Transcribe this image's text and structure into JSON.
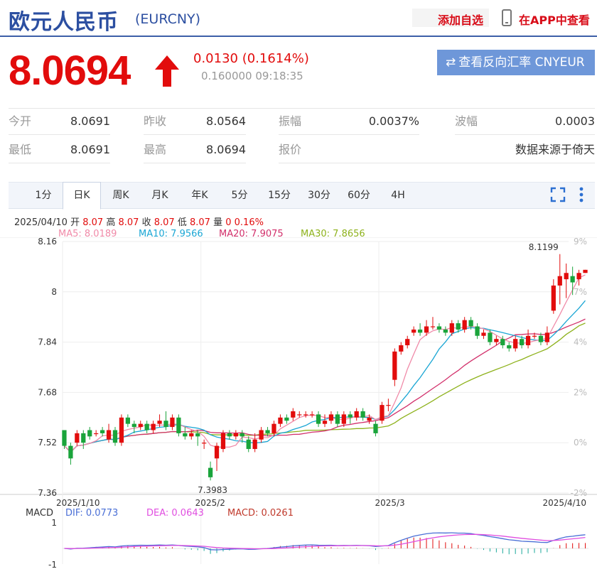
{
  "header": {
    "name": "欧元人民币",
    "code": "(EURCNY)",
    "add_watch": "添加自选",
    "app_view": "在APP中查看"
  },
  "quote": {
    "price": "8.0694",
    "change": "0.0130 (0.1614%)",
    "sub": "0.160000 09:18:35",
    "reverse_button": "查看反向汇率 CNYEUR"
  },
  "stats": [
    {
      "label": "今开",
      "value": "8.0691"
    },
    {
      "label": "昨收",
      "value": "8.0564"
    },
    {
      "label": "振幅",
      "value": "0.0037%"
    },
    {
      "label": "波幅",
      "value": "0.0003"
    },
    {
      "label": "最低",
      "value": "8.0691"
    },
    {
      "label": "最高",
      "value": "8.0694"
    },
    {
      "label": "报价",
      "value": ""
    },
    {
      "label": "",
      "value": "数据来源于倚天"
    }
  ],
  "tabs": [
    "1分",
    "日K",
    "周K",
    "月K",
    "年K",
    "5分",
    "15分",
    "30分",
    "60分",
    "4H"
  ],
  "active_tab": "日K",
  "info": {
    "date": "2025/04/10",
    "open_label": "开",
    "open": "8.07",
    "high_label": "高",
    "high": "8.07",
    "close_label": "收",
    "close": "8.07",
    "low_label": "低",
    "low": "8.07",
    "vol_label": "量",
    "vol": "0",
    "pct": "0.16%"
  },
  "ma_legend": [
    {
      "text": "MA5: 8.0189",
      "color": "#f08aa8"
    },
    {
      "text": "MA10: 7.9566",
      "color": "#1aa6d4"
    },
    {
      "text": "MA20: 7.9075",
      "color": "#d2306b"
    },
    {
      "text": "MA30: 7.8656",
      "color": "#8eb21c"
    }
  ],
  "macd_legend": {
    "label": "MACD",
    "dif": "DIF: 0.0773",
    "dea": "DEA: 0.0643",
    "macd": "MACD: 0.0261"
  },
  "colors": {
    "up": "#e20c0c",
    "down": "#1aa43b",
    "accent": "#2c4fa1",
    "button": "#6e97d9"
  },
  "chart_data": {
    "type": "candlestick",
    "y_ticks": [
      "8.16",
      "8",
      "7.84",
      "7.68",
      "7.52",
      "7.36"
    ],
    "y_pct_ticks": [
      "9%",
      "7%",
      "4%",
      "2%",
      "0%",
      "-2%"
    ],
    "x_ticks": [
      "2025/1/10",
      "2025/2",
      "2025/3",
      "2025/4/10"
    ],
    "ylim": [
      7.36,
      8.16
    ],
    "annotations": {
      "max": "8.1199",
      "min": "7.3983"
    },
    "macd_y_ticks": [
      "1",
      "-1"
    ],
    "candles": [
      {
        "o": 7.56,
        "c": 7.51,
        "h": 7.56,
        "l": 7.5
      },
      {
        "o": 7.51,
        "c": 7.47,
        "h": 7.52,
        "l": 7.45
      },
      {
        "o": 7.52,
        "c": 7.55,
        "h": 7.56,
        "l": 7.51
      },
      {
        "o": 7.55,
        "c": 7.52,
        "h": 7.56,
        "l": 7.5
      },
      {
        "o": 7.56,
        "c": 7.54,
        "h": 7.57,
        "l": 7.53
      },
      {
        "o": 7.55,
        "c": 7.55,
        "h": 7.56,
        "l": 7.54
      },
      {
        "o": 7.56,
        "c": 7.55,
        "h": 7.57,
        "l": 7.54
      },
      {
        "o": 7.53,
        "c": 7.56,
        "h": 7.58,
        "l": 7.52
      },
      {
        "o": 7.56,
        "c": 7.52,
        "h": 7.57,
        "l": 7.51
      },
      {
        "o": 7.52,
        "c": 7.6,
        "h": 7.61,
        "l": 7.51
      },
      {
        "o": 7.6,
        "c": 7.58,
        "h": 7.61,
        "l": 7.57
      },
      {
        "o": 7.58,
        "c": 7.57,
        "h": 7.59,
        "l": 7.55
      },
      {
        "o": 7.57,
        "c": 7.58,
        "h": 7.59,
        "l": 7.56
      },
      {
        "o": 7.58,
        "c": 7.56,
        "h": 7.59,
        "l": 7.55
      },
      {
        "o": 7.56,
        "c": 7.58,
        "h": 7.59,
        "l": 7.55
      },
      {
        "o": 7.58,
        "c": 7.59,
        "h": 7.61,
        "l": 7.57
      },
      {
        "o": 7.59,
        "c": 7.57,
        "h": 7.62,
        "l": 7.56
      },
      {
        "o": 7.57,
        "c": 7.6,
        "h": 7.61,
        "l": 7.56
      },
      {
        "o": 7.6,
        "c": 7.55,
        "h": 7.61,
        "l": 7.54
      },
      {
        "o": 7.55,
        "c": 7.54,
        "h": 7.57,
        "l": 7.53
      },
      {
        "o": 7.54,
        "c": 7.55,
        "h": 7.56,
        "l": 7.53
      },
      {
        "o": 7.55,
        "c": 7.54,
        "h": 7.56,
        "l": 7.51
      },
      {
        "o": 7.52,
        "c": 7.52,
        "h": 7.53,
        "l": 7.5
      },
      {
        "o": 7.44,
        "c": 7.41,
        "h": 7.46,
        "l": 7.4
      },
      {
        "o": 7.47,
        "c": 7.51,
        "h": 7.52,
        "l": 7.43
      },
      {
        "o": 7.5,
        "c": 7.55,
        "h": 7.56,
        "l": 7.49
      },
      {
        "o": 7.55,
        "c": 7.54,
        "h": 7.56,
        "l": 7.53
      },
      {
        "o": 7.54,
        "c": 7.55,
        "h": 7.56,
        "l": 7.53
      },
      {
        "o": 7.55,
        "c": 7.54,
        "h": 7.56,
        "l": 7.52
      },
      {
        "o": 7.53,
        "c": 7.5,
        "h": 7.54,
        "l": 7.49
      },
      {
        "o": 7.5,
        "c": 7.53,
        "h": 7.55,
        "l": 7.49
      },
      {
        "o": 7.53,
        "c": 7.56,
        "h": 7.57,
        "l": 7.52
      },
      {
        "o": 7.56,
        "c": 7.55,
        "h": 7.57,
        "l": 7.54
      },
      {
        "o": 7.55,
        "c": 7.58,
        "h": 7.59,
        "l": 7.54
      },
      {
        "o": 7.58,
        "c": 7.6,
        "h": 7.61,
        "l": 7.57
      },
      {
        "o": 7.6,
        "c": 7.59,
        "h": 7.61,
        "l": 7.58
      },
      {
        "o": 7.6,
        "c": 7.62,
        "h": 7.63,
        "l": 7.59
      },
      {
        "o": 7.61,
        "c": 7.61,
        "h": 7.62,
        "l": 7.6
      },
      {
        "o": 7.61,
        "c": 7.61,
        "h": 7.62,
        "l": 7.6
      },
      {
        "o": 7.61,
        "c": 7.61,
        "h": 7.62,
        "l": 7.6
      },
      {
        "o": 7.61,
        "c": 7.58,
        "h": 7.62,
        "l": 7.57
      },
      {
        "o": 7.58,
        "c": 7.59,
        "h": 7.61,
        "l": 7.57
      },
      {
        "o": 7.59,
        "c": 7.61,
        "h": 7.62,
        "l": 7.58
      },
      {
        "o": 7.61,
        "c": 7.58,
        "h": 7.62,
        "l": 7.57
      },
      {
        "o": 7.58,
        "c": 7.61,
        "h": 7.62,
        "l": 7.57
      },
      {
        "o": 7.61,
        "c": 7.6,
        "h": 7.62,
        "l": 7.58
      },
      {
        "o": 7.6,
        "c": 7.62,
        "h": 7.63,
        "l": 7.59
      },
      {
        "o": 7.62,
        "c": 7.6,
        "h": 7.63,
        "l": 7.59
      },
      {
        "o": 7.59,
        "c": 7.6,
        "h": 7.61,
        "l": 7.58
      },
      {
        "o": 7.58,
        "c": 7.55,
        "h": 7.59,
        "l": 7.54
      },
      {
        "o": 7.59,
        "c": 7.64,
        "h": 7.65,
        "l": 7.58
      },
      {
        "o": 7.64,
        "c": 7.64,
        "h": 7.66,
        "l": 7.62
      },
      {
        "o": 7.72,
        "c": 7.81,
        "h": 7.82,
        "l": 7.7
      },
      {
        "o": 7.81,
        "c": 7.83,
        "h": 7.84,
        "l": 7.8
      },
      {
        "o": 7.83,
        "c": 7.85,
        "h": 7.86,
        "l": 7.82
      },
      {
        "o": 7.87,
        "c": 7.88,
        "h": 7.89,
        "l": 7.86
      },
      {
        "o": 7.88,
        "c": 7.87,
        "h": 7.9,
        "l": 7.86
      },
      {
        "o": 7.87,
        "c": 7.89,
        "h": 7.91,
        "l": 7.86
      },
      {
        "o": 7.89,
        "c": 7.89,
        "h": 7.92,
        "l": 7.88
      },
      {
        "o": 7.89,
        "c": 7.88,
        "h": 7.9,
        "l": 7.87
      },
      {
        "o": 7.88,
        "c": 7.87,
        "h": 7.89,
        "l": 7.86
      },
      {
        "o": 7.87,
        "c": 7.9,
        "h": 7.91,
        "l": 7.86
      },
      {
        "o": 7.9,
        "c": 7.88,
        "h": 7.91,
        "l": 7.87
      },
      {
        "o": 7.88,
        "c": 7.91,
        "h": 7.92,
        "l": 7.87
      },
      {
        "o": 7.91,
        "c": 7.89,
        "h": 7.92,
        "l": 7.88
      },
      {
        "o": 7.89,
        "c": 7.86,
        "h": 7.9,
        "l": 7.85
      },
      {
        "o": 7.86,
        "c": 7.87,
        "h": 7.88,
        "l": 7.85
      },
      {
        "o": 7.87,
        "c": 7.84,
        "h": 7.88,
        "l": 7.83
      },
      {
        "o": 7.84,
        "c": 7.85,
        "h": 7.86,
        "l": 7.83
      },
      {
        "o": 7.85,
        "c": 7.83,
        "h": 7.86,
        "l": 7.82
      },
      {
        "o": 7.83,
        "c": 7.82,
        "h": 7.84,
        "l": 7.81
      },
      {
        "o": 7.82,
        "c": 7.85,
        "h": 7.86,
        "l": 7.81
      },
      {
        "o": 7.85,
        "c": 7.83,
        "h": 7.86,
        "l": 7.82
      },
      {
        "o": 7.83,
        "c": 7.86,
        "h": 7.88,
        "l": 7.82
      },
      {
        "o": 7.86,
        "c": 7.86,
        "h": 7.87,
        "l": 7.85
      },
      {
        "o": 7.86,
        "c": 7.84,
        "h": 7.87,
        "l": 7.83
      },
      {
        "o": 7.84,
        "c": 7.87,
        "h": 7.89,
        "l": 7.83
      },
      {
        "o": 7.94,
        "c": 8.02,
        "h": 8.04,
        "l": 7.93
      },
      {
        "o": 8.02,
        "c": 8.05,
        "h": 8.12,
        "l": 7.96
      },
      {
        "o": 8.04,
        "c": 8.06,
        "h": 8.09,
        "l": 7.98
      },
      {
        "o": 8.05,
        "c": 8.03,
        "h": 8.08,
        "l": 7.99
      },
      {
        "o": 8.04,
        "c": 8.06,
        "h": 8.07,
        "l": 8.02
      },
      {
        "o": 8.06,
        "c": 8.07,
        "h": 8.07,
        "l": 8.06
      }
    ]
  }
}
